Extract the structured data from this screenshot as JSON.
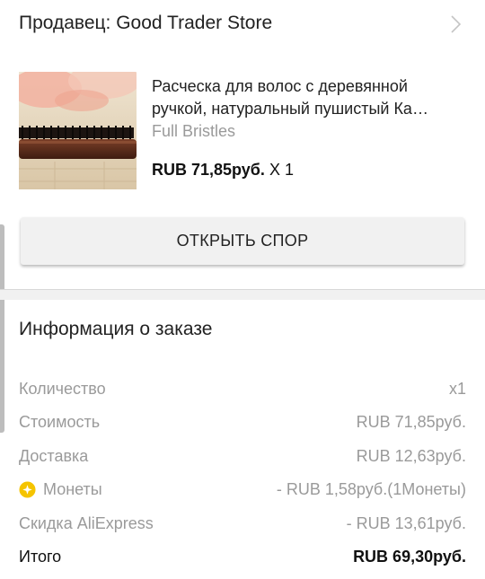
{
  "seller": {
    "label": "Продавец: Good Trader Store",
    "chevron_icon": "chevron-right-icon"
  },
  "product": {
    "title": "Расческа для волос с деревянной ручкой, натуральный пушистый Ка…",
    "variant": "Full Bristles",
    "price": "RUB 71,85руб.",
    "quantity": "X 1"
  },
  "dispute_button": {
    "label": "ОТКРЫТЬ СПОР"
  },
  "order_info": {
    "title": "Информация о заказе",
    "rows": [
      {
        "label": "Количество",
        "value": "x1"
      },
      {
        "label": "Стоимость",
        "value": "RUB 71,85руб."
      },
      {
        "label": "Доставка",
        "value": "RUB 12,63руб."
      },
      {
        "label": "Монеты",
        "value": "- RUB 1,58руб.(1Монеты)",
        "icon": "coin-icon"
      },
      {
        "label": "Скидка AliExpress",
        "value": "- RUB 13,61руб."
      },
      {
        "label": "Итого",
        "value": "RUB 69,30руб."
      }
    ]
  },
  "colors": {
    "text_primary": "#222222",
    "text_secondary": "#9a9a9a",
    "button_bg": "#f1f1f1",
    "coin": "#f5c400"
  }
}
